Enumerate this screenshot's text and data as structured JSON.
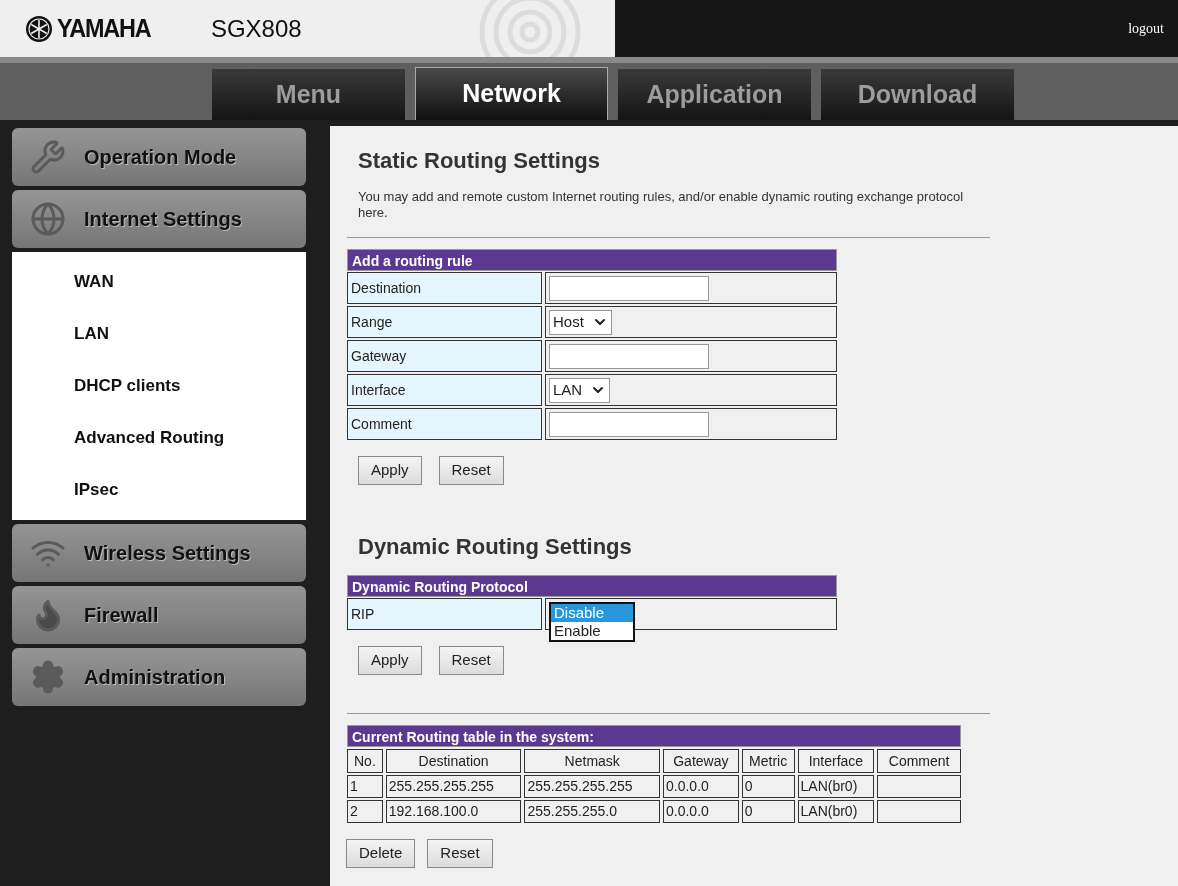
{
  "header": {
    "brand": "YAMAHA",
    "model": "SGX808",
    "logout": "logout"
  },
  "tabs": [
    {
      "label": "Menu",
      "selected": false
    },
    {
      "label": "Network",
      "selected": true
    },
    {
      "label": "Application",
      "selected": false
    },
    {
      "label": "Download",
      "selected": false
    }
  ],
  "sidebar": {
    "items": [
      {
        "label": "Operation Mode",
        "kind": "wrench"
      },
      {
        "label": "Internet Settings",
        "kind": "globe",
        "children": [
          {
            "label": "WAN"
          },
          {
            "label": "LAN"
          },
          {
            "label": "DHCP clients"
          },
          {
            "label": "Advanced Routing"
          },
          {
            "label": "IPsec"
          }
        ]
      },
      {
        "label": "Wireless Settings",
        "kind": "wifi"
      },
      {
        "label": "Firewall",
        "kind": "firewall"
      },
      {
        "label": "Administration",
        "kind": "gear"
      }
    ]
  },
  "static_routing": {
    "title": "Static Routing Settings",
    "description": "You may add and remote custom Internet routing rules, and/or enable dynamic routing exchange protocol here.",
    "form": {
      "title": "Add a routing rule",
      "rows": [
        {
          "label": "Destination",
          "kind": "text"
        },
        {
          "label": "Range",
          "kind": "select",
          "value": "Host"
        },
        {
          "label": "Gateway",
          "kind": "text"
        },
        {
          "label": "Interface",
          "kind": "select",
          "value": "LAN"
        },
        {
          "label": "Comment",
          "kind": "text"
        }
      ]
    },
    "buttons": [
      "Apply",
      "Reset"
    ]
  },
  "dynamic_routing": {
    "title": "Dynamic Routing Settings",
    "form": {
      "title": "Dynamic Routing Protocol",
      "label": "RIP",
      "options": [
        {
          "label": "Disable",
          "selected": true
        },
        {
          "label": "Enable",
          "selected": false
        }
      ]
    },
    "buttons": [
      "Apply",
      "Reset"
    ]
  },
  "routing_table": {
    "title": "Current Routing table in the system:",
    "columns": [
      "No.",
      "Destination",
      "Netmask",
      "Gateway",
      "Metric",
      "Interface",
      "Comment"
    ],
    "rows": [
      [
        "1",
        "255.255.255.255",
        "255.255.255.255",
        "0.0.0.0",
        "0",
        "LAN(br0)",
        ""
      ],
      [
        "2",
        "192.168.100.0",
        "255.255.255.0",
        "0.0.0.0",
        "0",
        "LAN(br0)",
        ""
      ]
    ],
    "buttons": [
      "Delete",
      "Reset"
    ]
  }
}
